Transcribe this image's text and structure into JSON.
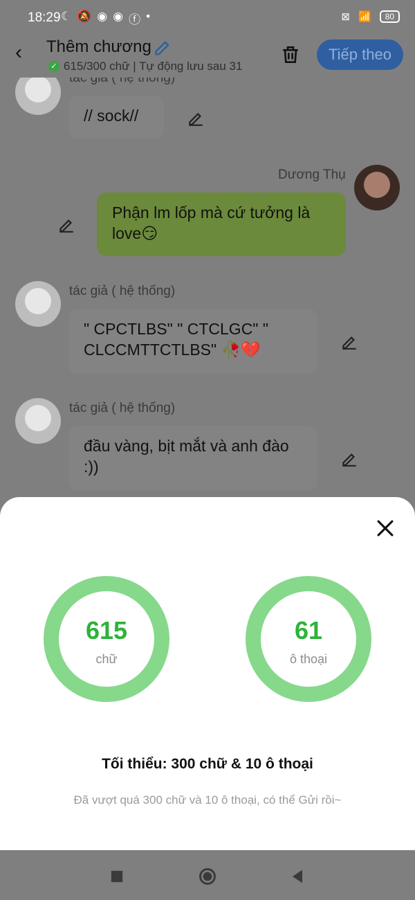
{
  "status": {
    "time": "18:29",
    "battery": "80"
  },
  "header": {
    "title": "Thêm chương",
    "save_status": "615/300 chữ | Tự động lưu sau 31",
    "next_label": "Tiếp theo"
  },
  "messages": [
    {
      "sender": "tác giả ( hệ thống)",
      "text": "// sock//"
    },
    {
      "sender": "Dương Thụ",
      "text": "Phận lm lốp mà cứ tưởng là love😏"
    },
    {
      "sender": "tác giả ( hệ thống)",
      "text": "\" CPCTLBS\" \" CTCLGC\" \" CLCCMTTCTLBS\" 🥀💔"
    },
    {
      "sender": "tác giả ( hệ thống)",
      "text": "đầu vàng, bịt mắt và anh đào :))"
    }
  ],
  "stats": {
    "words_value": "615",
    "words_label": "chữ",
    "dialogs_value": "61",
    "dialogs_label": "ô thoại",
    "minimum": "Tối thiểu: 300 chữ & 10 ô thoại",
    "info": "Đã vượt quá 300 chữ và 10 ô thoại, có thể Gửi rồi~"
  },
  "colors": {
    "ring": "#86d88b",
    "value_text": "#2db33a",
    "primary_button": "#2f5fa0",
    "author_bubble_green": "#6b8a3b"
  },
  "icons": [
    "moon-icon",
    "bell-off-icon",
    "messenger-icon",
    "facebook-icon",
    "wifi-icon",
    "pencil-icon",
    "trash-icon",
    "close-icon"
  ]
}
